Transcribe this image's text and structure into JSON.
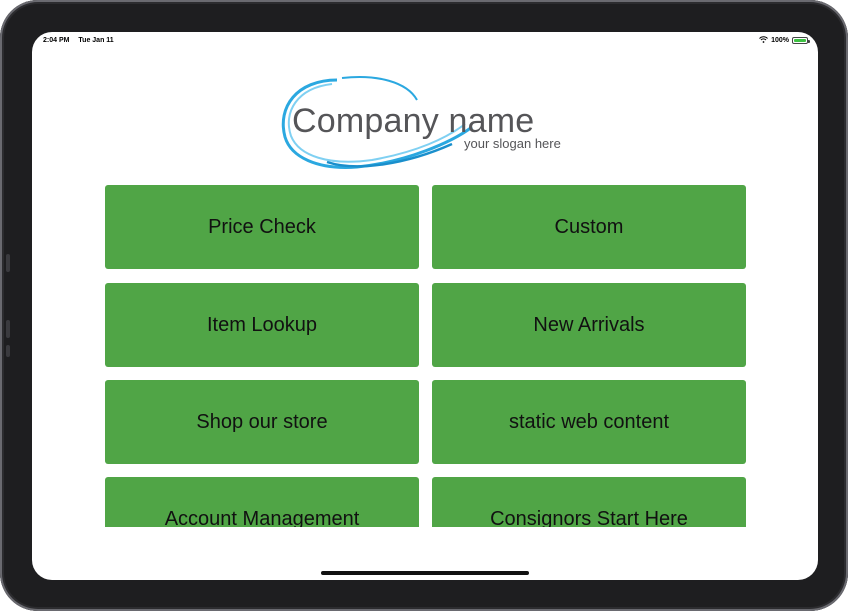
{
  "status_bar": {
    "time": "2:04 PM",
    "date": "Tue Jan 11",
    "battery": "100%",
    "battery_level": 1.0
  },
  "logo": {
    "name": "Company name",
    "slogan": "your slogan here"
  },
  "menu": {
    "items": [
      {
        "label": "Price Check"
      },
      {
        "label": "Custom"
      },
      {
        "label": "Item Lookup"
      },
      {
        "label": "New Arrivals"
      },
      {
        "label": "Shop our store"
      },
      {
        "label": "static web content"
      },
      {
        "label": "Account Management"
      },
      {
        "label": "Consignors Start Here"
      }
    ]
  },
  "colors": {
    "tile": "#50a546",
    "logo_swoosh": "#2ba8e0",
    "device_frame": "#1e1e20"
  },
  "icons": {
    "wifi": "wifi-icon",
    "battery": "battery-icon"
  }
}
